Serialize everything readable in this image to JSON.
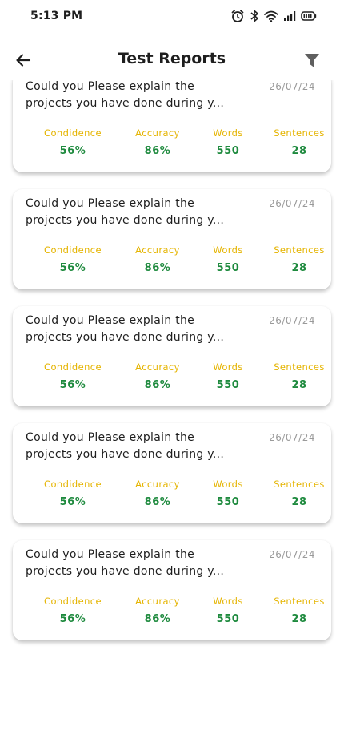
{
  "status_bar": {
    "time": "5:13 PM",
    "icons": [
      "alarm-icon",
      "bluetooth-icon",
      "wifi-icon",
      "signal-icon",
      "battery-icon"
    ]
  },
  "header": {
    "title": "Test Reports",
    "back_icon": "arrow-back-icon",
    "filter_icon": "filter-icon"
  },
  "colors": {
    "metric_label": "#e5b400",
    "metric_value": "#1e8a3e",
    "date": "#9a9a9a"
  },
  "reports": [
    {
      "question_line1": "Could you Please explain the",
      "question_line2": "projects you have done during y...",
      "date": "26/07/24",
      "metrics": [
        {
          "label": "Condidence",
          "value": "56%"
        },
        {
          "label": "Accuracy",
          "value": "86%"
        },
        {
          "label": "Words",
          "value": "550"
        },
        {
          "label": "Sentences",
          "value": "28"
        }
      ]
    },
    {
      "question_line1": "Could you Please explain the",
      "question_line2": "projects you have done during y...",
      "date": "26/07/24",
      "metrics": [
        {
          "label": "Condidence",
          "value": "56%"
        },
        {
          "label": "Accuracy",
          "value": "86%"
        },
        {
          "label": "Words",
          "value": "550"
        },
        {
          "label": "Sentences",
          "value": "28"
        }
      ]
    },
    {
      "question_line1": "Could you Please explain the",
      "question_line2": "projects you have done during y...",
      "date": "26/07/24",
      "metrics": [
        {
          "label": "Condidence",
          "value": "56%"
        },
        {
          "label": "Accuracy",
          "value": "86%"
        },
        {
          "label": "Words",
          "value": "550"
        },
        {
          "label": "Sentences",
          "value": "28"
        }
      ]
    },
    {
      "question_line1": "Could you Please explain the",
      "question_line2": "projects you have done during y...",
      "date": "26/07/24",
      "metrics": [
        {
          "label": "Condidence",
          "value": "56%"
        },
        {
          "label": "Accuracy",
          "value": "86%"
        },
        {
          "label": "Words",
          "value": "550"
        },
        {
          "label": "Sentences",
          "value": "28"
        }
      ]
    },
    {
      "question_line1": "Could you Please explain the",
      "question_line2": "projects you have done during y...",
      "date": "26/07/24",
      "metrics": [
        {
          "label": "Condidence",
          "value": "56%"
        },
        {
          "label": "Accuracy",
          "value": "86%"
        },
        {
          "label": "Words",
          "value": "550"
        },
        {
          "label": "Sentences",
          "value": "28"
        }
      ]
    }
  ]
}
